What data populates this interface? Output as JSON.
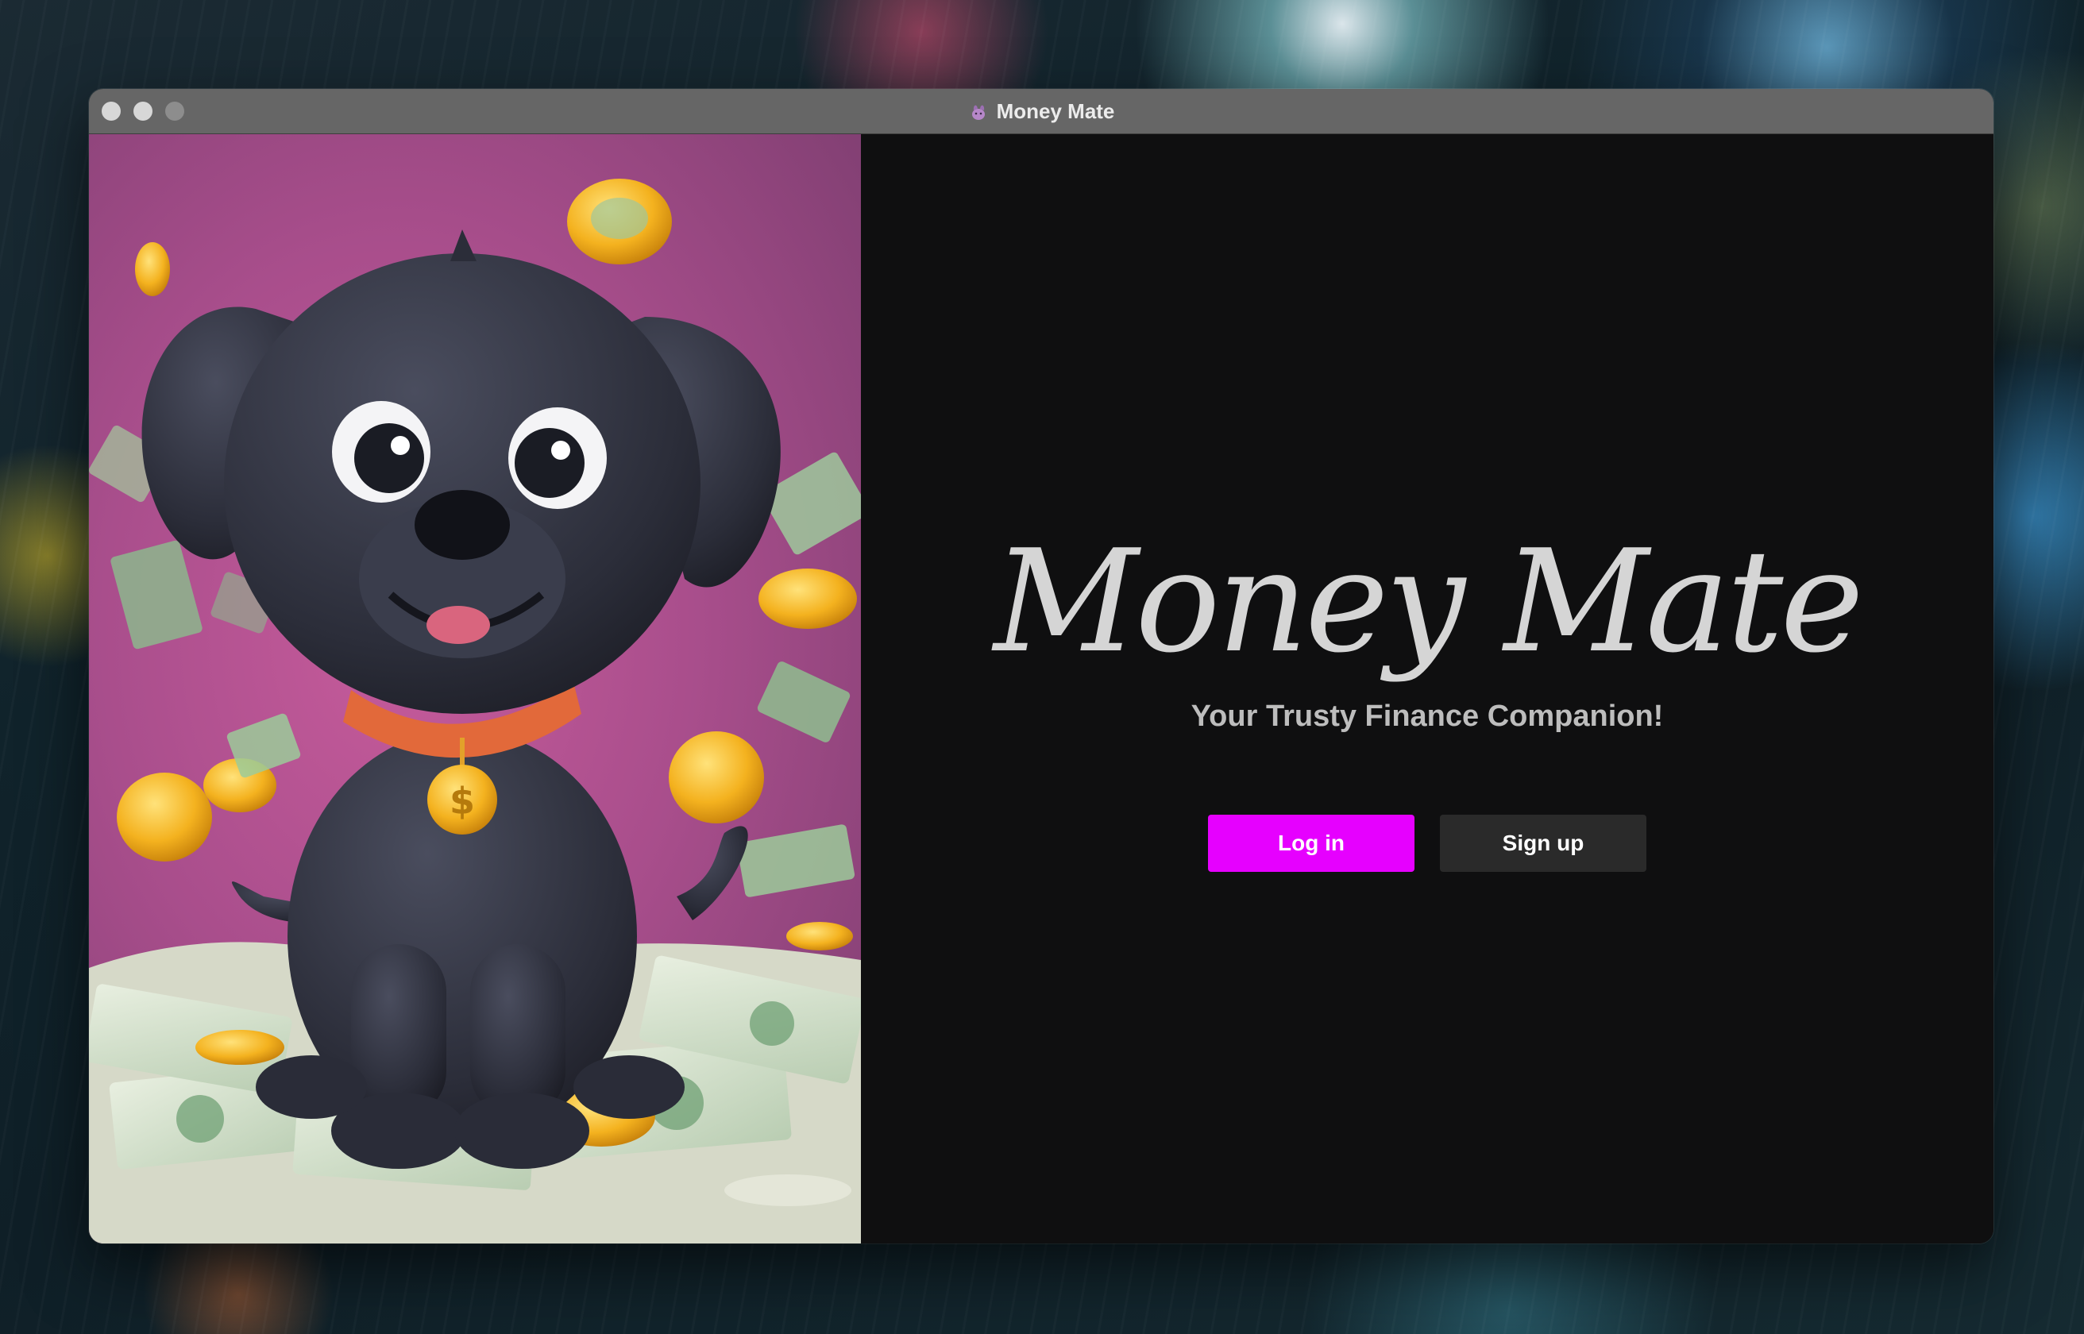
{
  "window": {
    "title": "Money Mate",
    "app_icon": "dog-paw-icon"
  },
  "hero": {
    "illustration": "cartoon black puppy with gold dollar tag sitting on money pile"
  },
  "welcome": {
    "brand": "Money Mate",
    "tagline": "Your Trusty Finance Companion!",
    "login_label": "Log in",
    "signup_label": "Sign up"
  },
  "colors": {
    "accent": "#e600ff",
    "panel_bg": "#0f0f10",
    "secondary_button": "#2a2a2a",
    "titlebar": "#666666"
  }
}
